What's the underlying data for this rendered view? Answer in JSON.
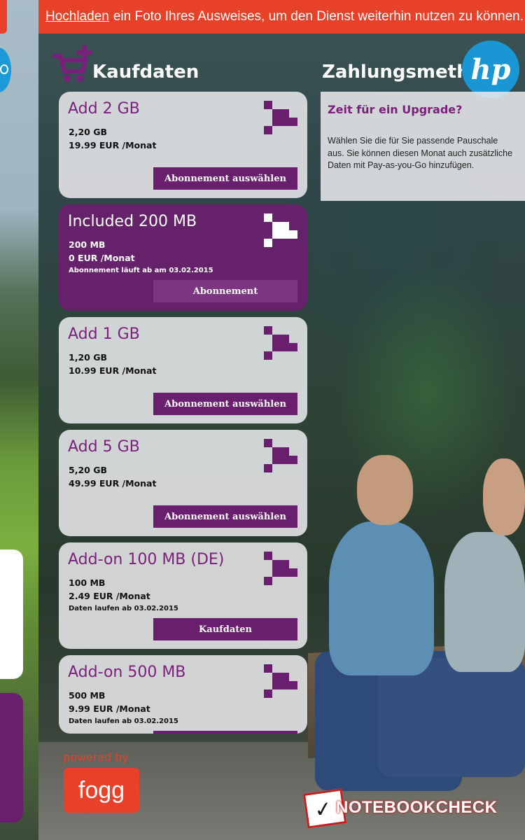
{
  "banner": {
    "link": "Hochladen",
    "text": "ein Foto Ihres Ausweises, um den Dienst weiterhin nutzen zu können."
  },
  "headings": {
    "purchase": "Kaufdaten",
    "payment": "Zahlungsmethode"
  },
  "brand_logo": "hp",
  "cards": [
    {
      "title": "Add 2 GB",
      "size": "2,20 GB",
      "price": "19.99 EUR /Monat",
      "note": "",
      "button": "Abonnement auswählen",
      "active": false
    },
    {
      "title": "Included 200 MB",
      "size": "200 MB",
      "price": "0 EUR /Monat",
      "note": "Abonnement läuft ab am 03.02.2015",
      "button": "Abonnement",
      "active": true
    },
    {
      "title": "Add 1 GB",
      "size": "1,20 GB",
      "price": "10.99 EUR /Monat",
      "note": "",
      "button": "Abonnement auswählen",
      "active": false
    },
    {
      "title": "Add 5 GB",
      "size": "5,20 GB",
      "price": "49.99 EUR /Monat",
      "note": "",
      "button": "Abonnement auswählen",
      "active": false
    },
    {
      "title": "Add-on 100 MB (DE)",
      "size": "100 MB",
      "price": "2.49 EUR /Monat",
      "note": "Daten laufen ab 03.02.2015",
      "button": "Kaufdaten",
      "active": false
    },
    {
      "title": "Add-on 500 MB",
      "size": "500 MB",
      "price": "9.99 EUR /Monat",
      "note": "Daten laufen ab 03.02.2015",
      "button": "",
      "active": false
    }
  ],
  "payment": {
    "title": "Zeit für ein Upgrade?",
    "text": "Wählen Sie die für Sie passende Pauschale aus.  Sie können diesen Monat auch zusätzliche Daten mit Pay-as-you-Go hinzufügen."
  },
  "footer": {
    "powered_by": "powered by",
    "fogg": "fogg",
    "watermark": "NOTEBOOKCHECK"
  },
  "colors": {
    "accent": "#6a1f6e",
    "banner": "#e8412a",
    "hp_blue": "#1b96d4"
  }
}
